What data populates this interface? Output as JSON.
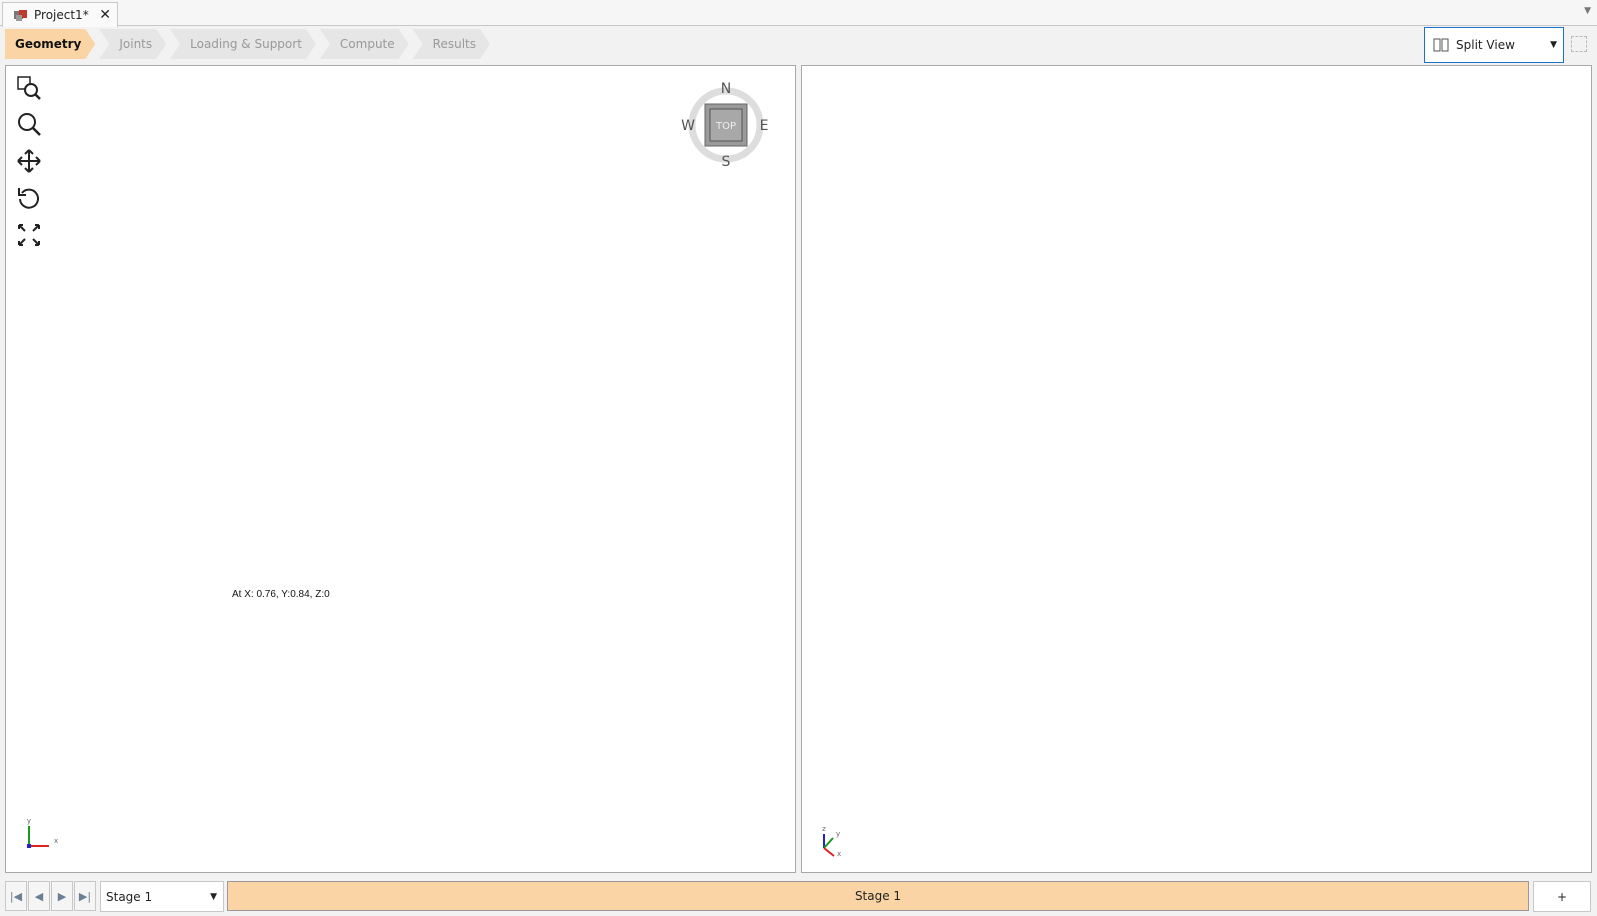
{
  "tab": {
    "title": "Project1*",
    "close": "✕"
  },
  "workflow": [
    {
      "label": "Geometry",
      "active": true
    },
    {
      "label": "Joints"
    },
    {
      "label": "Loading & Support"
    },
    {
      "label": "Compute"
    },
    {
      "label": "Results"
    }
  ],
  "view_select": {
    "value": "Split View"
  },
  "left_view": {
    "coords": "At X: 0.76, Y:0.84, Z:0",
    "compass": {
      "n": "N",
      "s": "S",
      "e": "E",
      "w": "W",
      "face": "TOP"
    },
    "axes": {
      "x": "x",
      "y": "y"
    }
  },
  "right_view": {
    "axes": {
      "x": "x",
      "y": "y",
      "z": "z"
    }
  },
  "stages": {
    "selected": "Stage 1",
    "bar_label": "Stage 1",
    "add": "+",
    "accent": "#fad4a4"
  }
}
